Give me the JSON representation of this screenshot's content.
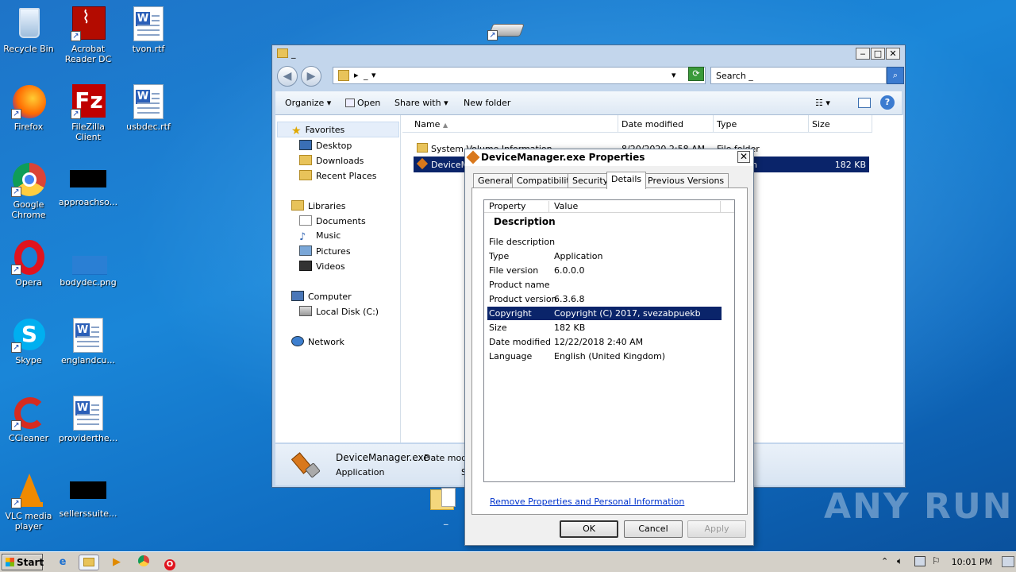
{
  "desktop": {
    "icons": [
      {
        "label": "Recycle Bin",
        "icon": "recycle-bin-icon"
      },
      {
        "label": "Acrobat Reader DC",
        "icon": "acrobat-icon"
      },
      {
        "label": "tvon.rtf",
        "icon": "word-document-icon"
      },
      {
        "label": "Firefox",
        "icon": "firefox-icon"
      },
      {
        "label": "FileZilla Client",
        "icon": "filezilla-icon"
      },
      {
        "label": "usbdec.rtf",
        "icon": "word-document-icon"
      },
      {
        "label": "Google Chrome",
        "icon": "chrome-icon"
      },
      {
        "label": "approachso...",
        "icon": "black-file-icon"
      },
      {
        "label": "Opera",
        "icon": "opera-icon"
      },
      {
        "label": "bodydec.png",
        "icon": "png-file-icon"
      },
      {
        "label": "Skype",
        "icon": "skype-icon"
      },
      {
        "label": "englandcu...",
        "icon": "word-document-icon"
      },
      {
        "label": "CCleaner",
        "icon": "ccleaner-icon"
      },
      {
        "label": "providerthe...",
        "icon": "word-document-icon"
      },
      {
        "label": "VLC media player",
        "icon": "vlc-icon"
      },
      {
        "label": "sellerssuite...",
        "icon": "black-file-icon"
      }
    ],
    "drive_label": "_",
    "watermark": "ANY RUN"
  },
  "explorer": {
    "title": "_",
    "address": {
      "path": "_",
      "sep": "▸"
    },
    "search_placeholder": "Search _",
    "toolbar": {
      "organize": "Organize",
      "open": "Open",
      "share_with": "Share with",
      "new_folder": "New folder"
    },
    "nav": {
      "favorites": "Favorites",
      "desktop": "Desktop",
      "downloads": "Downloads",
      "recent": "Recent Places",
      "libraries": "Libraries",
      "documents": "Documents",
      "music": "Music",
      "pictures": "Pictures",
      "videos": "Videos",
      "computer": "Computer",
      "local_disk": "Local Disk (C:)",
      "network": "Network"
    },
    "columns": {
      "name": "Name",
      "date": "Date modified",
      "type": "Type",
      "size": "Size"
    },
    "rows": [
      {
        "name": "System Volume Information",
        "date": "8/20/2020 2:58 AM",
        "type": "File folder",
        "size": ""
      },
      {
        "name": "DeviceMa",
        "date": "",
        "type": "n",
        "size": "182 KB"
      }
    ],
    "status": {
      "filename": "DeviceManager.exe",
      "date_label": "Date modif",
      "type": "Application",
      "size_label": "S"
    }
  },
  "dialog": {
    "title": "DeviceManager.exe Properties",
    "tabs": [
      "General",
      "Compatibility",
      "Security",
      "Details",
      "Previous Versions"
    ],
    "active_tab": "Details",
    "headers": {
      "property": "Property",
      "value": "Value"
    },
    "group": "Description",
    "properties": [
      {
        "name": "File description",
        "value": ""
      },
      {
        "name": "Type",
        "value": "Application"
      },
      {
        "name": "File version",
        "value": "6.0.0.0"
      },
      {
        "name": "Product name",
        "value": ""
      },
      {
        "name": "Product version",
        "value": "6.3.6.8"
      },
      {
        "name": "Copyright",
        "value": "Copyright (C) 2017, svezabpuekb"
      },
      {
        "name": "Size",
        "value": "182 KB"
      },
      {
        "name": "Date modified",
        "value": "12/22/2018 2:40 AM"
      },
      {
        "name": "Language",
        "value": "English (United Kingdom)"
      }
    ],
    "selected_property": "Copyright",
    "remove_link": "Remove Properties and Personal Information",
    "buttons": {
      "ok": "OK",
      "cancel": "Cancel",
      "apply": "Apply"
    }
  },
  "taskbar": {
    "start": "Start",
    "clock": "10:01 PM"
  },
  "colors": {
    "selection": "#0a246a",
    "desktop_blue": "#1a86d8",
    "link": "#0033cc"
  }
}
